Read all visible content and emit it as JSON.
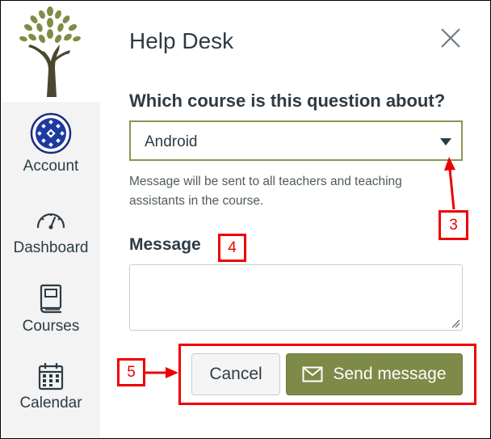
{
  "sidebar": {
    "items": [
      {
        "label": "Account",
        "icon": "account-avatar-icon"
      },
      {
        "label": "Dashboard",
        "icon": "dashboard-gauge-icon"
      },
      {
        "label": "Courses",
        "icon": "courses-book-icon"
      },
      {
        "label": "Calendar",
        "icon": "calendar-icon"
      }
    ]
  },
  "dialog": {
    "title": "Help Desk",
    "question": "Which course is this question about?",
    "course_selected": "Android",
    "help_text": "Message will be sent to all teachers and teaching assistants in the course.",
    "message_label": "Message",
    "message_value": "",
    "cancel_label": "Cancel",
    "send_label": "Send message"
  },
  "annotations": {
    "callout_3": "3",
    "callout_4": "4",
    "callout_5": "5"
  },
  "colors": {
    "accent": "#7d8a48",
    "select_border": "#8a9651",
    "annotation_red": "#e00000",
    "text": "#2d3b45"
  }
}
